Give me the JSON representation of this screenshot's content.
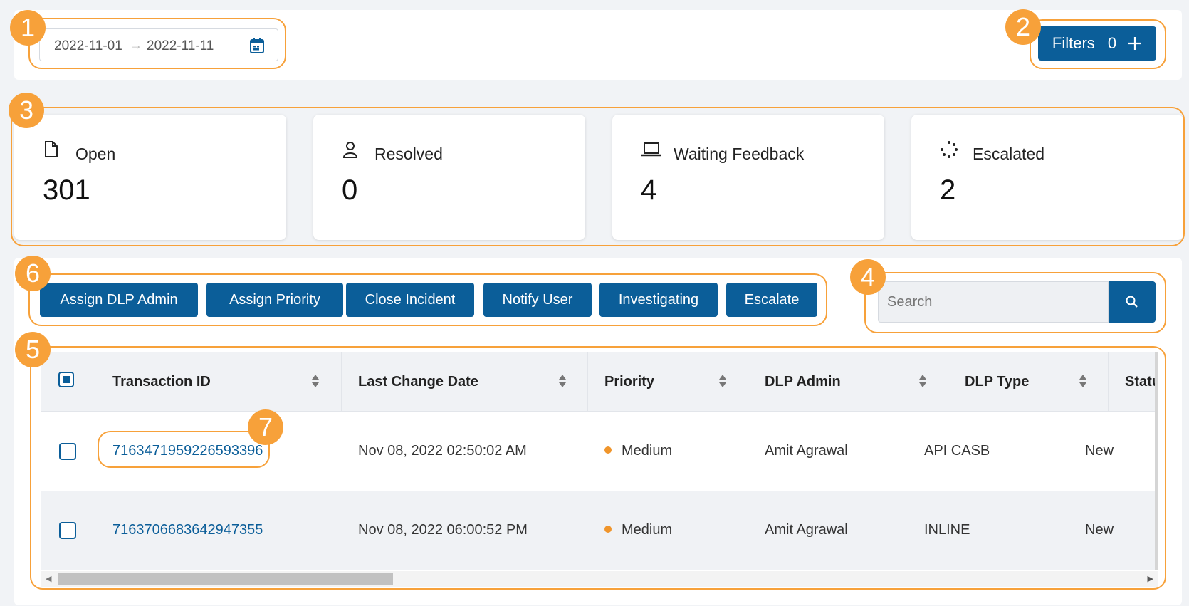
{
  "date_range": {
    "start": "2022-11-01",
    "end": "2022-11-11"
  },
  "filters": {
    "label": "Filters",
    "count": "0"
  },
  "stats": [
    {
      "label": "Open",
      "value": "301"
    },
    {
      "label": "Resolved",
      "value": "0"
    },
    {
      "label": "Waiting Feedback",
      "value": "4"
    },
    {
      "label": "Escalated",
      "value": "2"
    }
  ],
  "actions": [
    "Assign DLP Admin",
    "Assign Priority",
    "Close Incident",
    "Notify User",
    "Investigating",
    "Escalate"
  ],
  "search": {
    "placeholder": "Search"
  },
  "table": {
    "columns": [
      "Transaction ID",
      "Last Change Date",
      "Priority",
      "DLP Admin",
      "DLP Type",
      "Statu"
    ],
    "rows": [
      {
        "transaction_id": "7163471959226593396",
        "last_change": "Nov 08, 2022 02:50:02 AM",
        "priority": "Medium",
        "dlp_admin": "Amit Agrawal",
        "dlp_type": "API CASB",
        "status": "New"
      },
      {
        "transaction_id": "7163706683642947355",
        "last_change": "Nov 08, 2022 06:00:52 PM",
        "priority": "Medium",
        "dlp_admin": "Amit Agrawal",
        "dlp_type": "INLINE",
        "status": "New"
      }
    ]
  },
  "callouts": [
    "1",
    "2",
    "3",
    "4",
    "5",
    "6",
    "7"
  ],
  "colors": {
    "primary": "#0b5e99",
    "callout": "#f7a13a",
    "priority_medium": "#f0952b"
  }
}
